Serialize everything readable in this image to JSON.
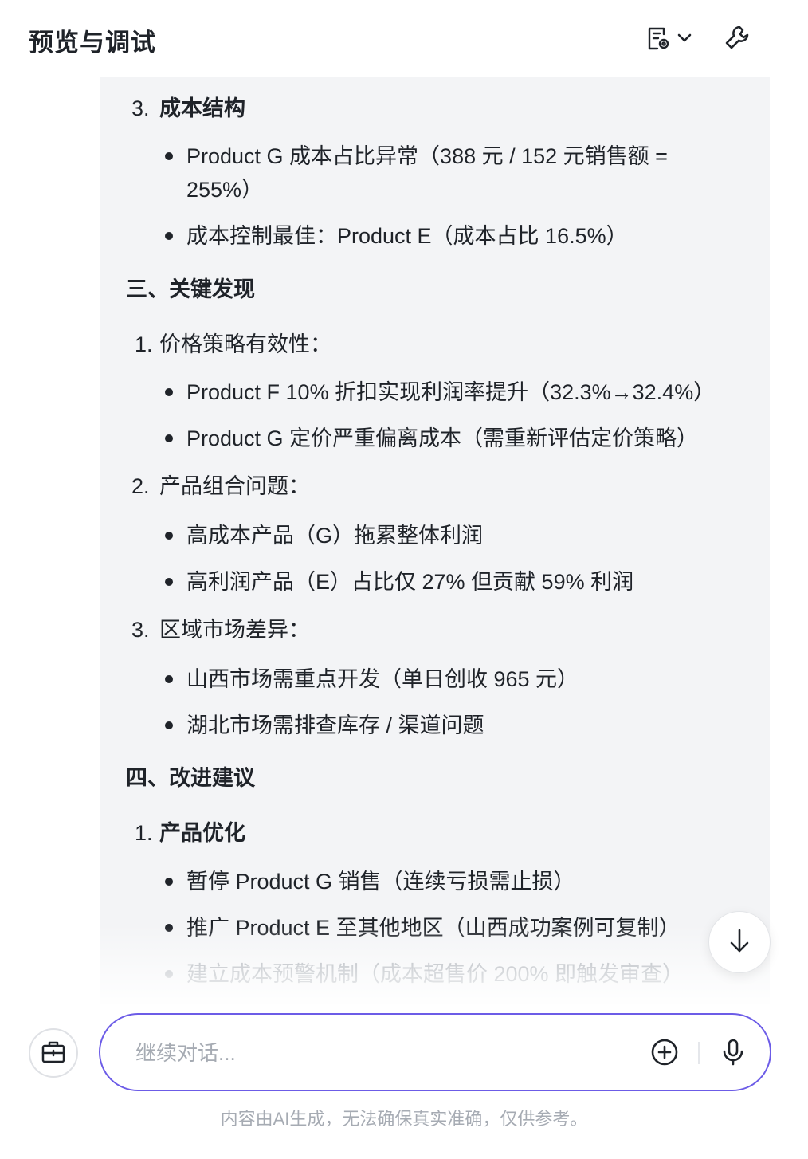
{
  "header": {
    "title": "预览与调试",
    "doc_icon": "document-settings-icon",
    "wrench_icon": "wrench-icon"
  },
  "content": {
    "lines": [
      {
        "num": "3.",
        "text": "成本结构",
        "bold": true
      },
      {
        "bullet": true,
        "text": "Product G 成本占比异常（388 元 / 152 元销售额 ="
      },
      {
        "text": "255%）"
      },
      {
        "bullet": true,
        "text": "成本控制最佳：Product E（成本占比 16.5%）"
      },
      {
        "text": "三、关键发现",
        "bold": true
      },
      {
        "num": "1.",
        "text": "价格策略有效性："
      },
      {
        "bullet": true,
        "text": "Product F 10% 折扣实现利润率提升（32.3%→32.4%）"
      },
      {
        "bullet": true,
        "text": "Product G 定价严重偏离成本（需重新评估定价策略）"
      },
      {
        "num": "2.",
        "text": "产品组合问题："
      },
      {
        "bullet": true,
        "text": "高成本产品（G）拖累整体利润"
      },
      {
        "bullet": true,
        "text": "高利润产品（E）占比仅 27% 但贡献 59% 利润"
      },
      {
        "num": "3.",
        "text": "区域市场差异："
      },
      {
        "bullet": true,
        "text": "山西市场需重点开发（单日创收 965 元）"
      },
      {
        "bullet": true,
        "text": "湖北市场需排查库存 / 渠道问题"
      },
      {
        "text": "四、改进建议",
        "bold": true
      },
      {
        "num": "1.",
        "text": "产品优化",
        "bold": true
      },
      {
        "bullet": true,
        "text": "暂停 Product G 销售（连续亏损需止损）"
      },
      {
        "bullet": true,
        "text": "推广 Product E 至其他地区（山西成功案例可复制）"
      },
      {
        "bullet": true,
        "text": "建立成本预警机制（成本超售价 200% 即触发审查）",
        "faded": true
      }
    ]
  },
  "scroll_button": {
    "icon": "arrow-down-icon"
  },
  "composer": {
    "placeholder": "继续对话...",
    "side_icon": "toolbox-icon",
    "attach_icon": "plus-circle-icon",
    "mic_icon": "microphone-icon"
  },
  "disclaimer": "内容由AI生成，无法确保真实准确，仅供参考。",
  "colors": {
    "accent": "#6c5ce7",
    "panel_bg": "#f3f4f6",
    "text": "#1f2329",
    "muted": "#a6abb3"
  }
}
